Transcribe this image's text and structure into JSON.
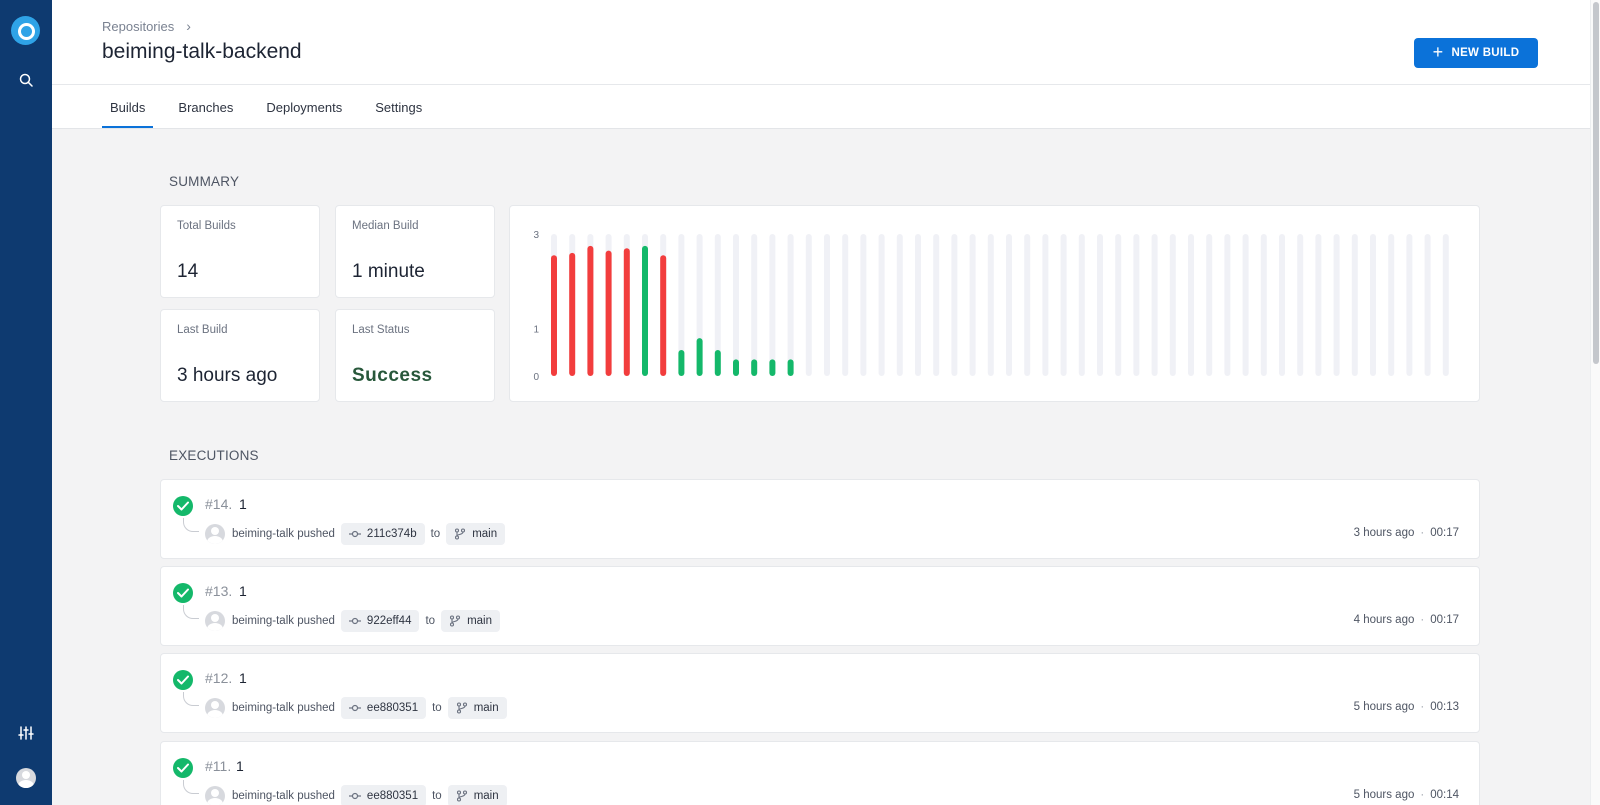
{
  "sidebar": {
    "icons": [
      "logo-icon",
      "search-icon",
      "sliders-icon",
      "user-avatar"
    ]
  },
  "header": {
    "breadcrumb": "Repositories",
    "title": "beiming-talk-backend",
    "new_build_label": "NEW BUILD",
    "tabs": [
      "Builds",
      "Branches",
      "Deployments",
      "Settings"
    ],
    "active_tab": "Builds"
  },
  "summary": {
    "label": "SUMMARY",
    "stats": [
      {
        "label": "Total Builds",
        "value": "14"
      },
      {
        "label": "Median Build",
        "value": "1 minute"
      },
      {
        "label": "Last Build",
        "value": "3 hours ago"
      },
      {
        "label": "Last Status",
        "value": "Success"
      }
    ]
  },
  "chart_data": {
    "type": "bar",
    "title": "",
    "xlabel": "",
    "ylabel": "",
    "ylim": [
      0,
      3
    ],
    "yticks": [
      "0",
      "1",
      "3"
    ],
    "slots": 50,
    "values": [
      2.55,
      2.6,
      2.75,
      2.65,
      2.7,
      2.75,
      2.55,
      0.55,
      0.8,
      0.55,
      0.35,
      0.35,
      0.35,
      0.35
    ],
    "statuses": [
      "failure",
      "failure",
      "failure",
      "failure",
      "failure",
      "success",
      "failure",
      "success",
      "success",
      "success",
      "success",
      "success",
      "success",
      "success"
    ],
    "colors": {
      "failure": "#f23d3d",
      "success": "#14b86a",
      "empty": "#f0f1f6"
    },
    "grid": false
  },
  "executions": {
    "label": "EXECUTIONS",
    "items": [
      {
        "number": "#14.",
        "name": "1",
        "actor": "beiming-talk pushed",
        "commit": "211c374b",
        "to": "to",
        "branch": "main",
        "time": "3 hours ago",
        "duration": "00:17"
      },
      {
        "number": "#13.",
        "name": "1",
        "actor": "beiming-talk pushed",
        "commit": "922eff44",
        "to": "to",
        "branch": "main",
        "time": "4 hours ago",
        "duration": "00:17"
      },
      {
        "number": "#12.",
        "name": "1",
        "actor": "beiming-talk pushed",
        "commit": "ee880351",
        "to": "to",
        "branch": "main",
        "time": "5 hours ago",
        "duration": "00:13"
      },
      {
        "number": "#11.",
        "name": "1",
        "actor": "beiming-talk pushed",
        "commit": "ee880351",
        "to": "to",
        "branch": "main",
        "time": "5 hours ago",
        "duration": "00:14"
      }
    ]
  }
}
